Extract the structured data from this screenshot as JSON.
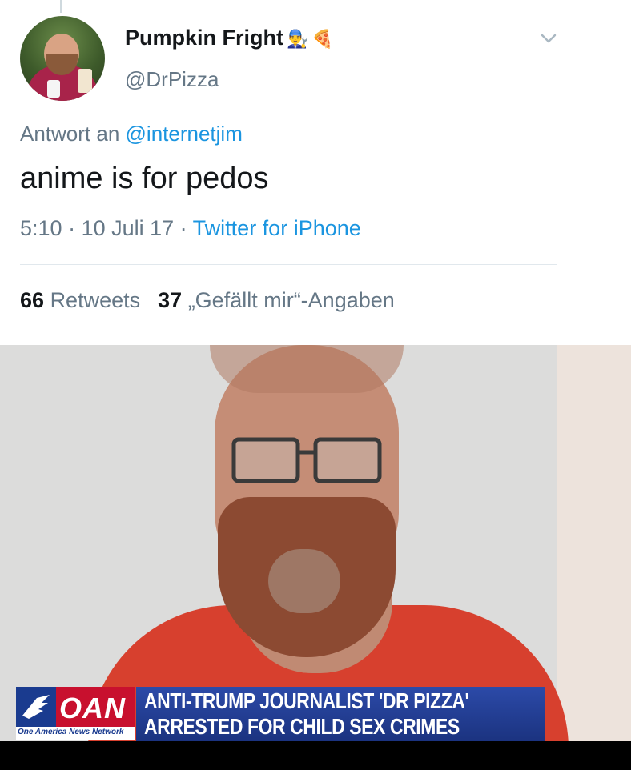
{
  "tweet": {
    "display_name": "Pumpkin Fright",
    "emojis": [
      "👨‍🔧",
      "🍕"
    ],
    "handle": "@DrPizza",
    "reply_prefix": "Antwort an",
    "reply_mention": "@internetjim",
    "text": "anime is for pedos",
    "time": "5:10",
    "date": "10 Juli 17",
    "source": "Twitter for iPhone",
    "retweets_count": "66",
    "retweets_label": "Retweets",
    "likes_count": "37",
    "likes_label": "„Gefällt mir“-Angaben"
  },
  "chyron": {
    "logo_text": "OAN",
    "network_text": "One America News Network",
    "line1": "ANTI-TRUMP JOURNALIST 'DR PIZZA'",
    "line2": "ARRESTED FOR CHILD SEX CRIMES"
  },
  "colors": {
    "link": "#1b95e0",
    "muted": "#657786",
    "text": "#14171a",
    "oan_red": "#c8102e",
    "oan_blue": "#1a3b8f"
  }
}
